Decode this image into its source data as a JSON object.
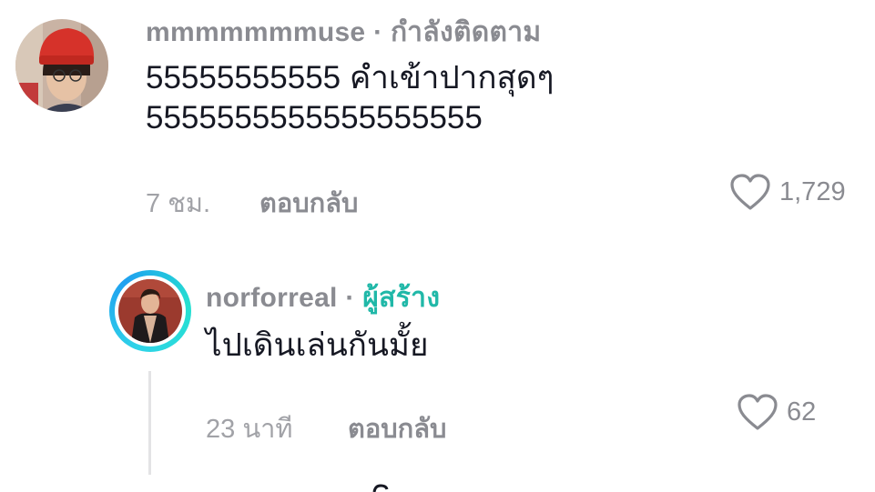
{
  "comments": [
    {
      "username": "mmmmmmmuse",
      "separator": "·",
      "status": "กำลังติดตาม",
      "text_line1": "55555555555 คำเข้าปากสุดๆ",
      "text_line2": "5555555555555555555",
      "time": "7 ชม.",
      "reply_label": "ตอบกลับ",
      "likes": "1,729"
    },
    {
      "username": "norforreal",
      "separator": "·",
      "status": "ผู้สร้าง",
      "text_line1": "ไปเดินเล่นกันมั้ย",
      "time": "23 นาที",
      "reply_label": "ตอบกลับ",
      "likes": "62"
    }
  ],
  "icons": {
    "like": "heart-outline-icon"
  },
  "colors": {
    "creator_tag": "#20b8a8",
    "avatar_ring": "#2fd3e8",
    "secondary_text": "#8a8b91"
  }
}
